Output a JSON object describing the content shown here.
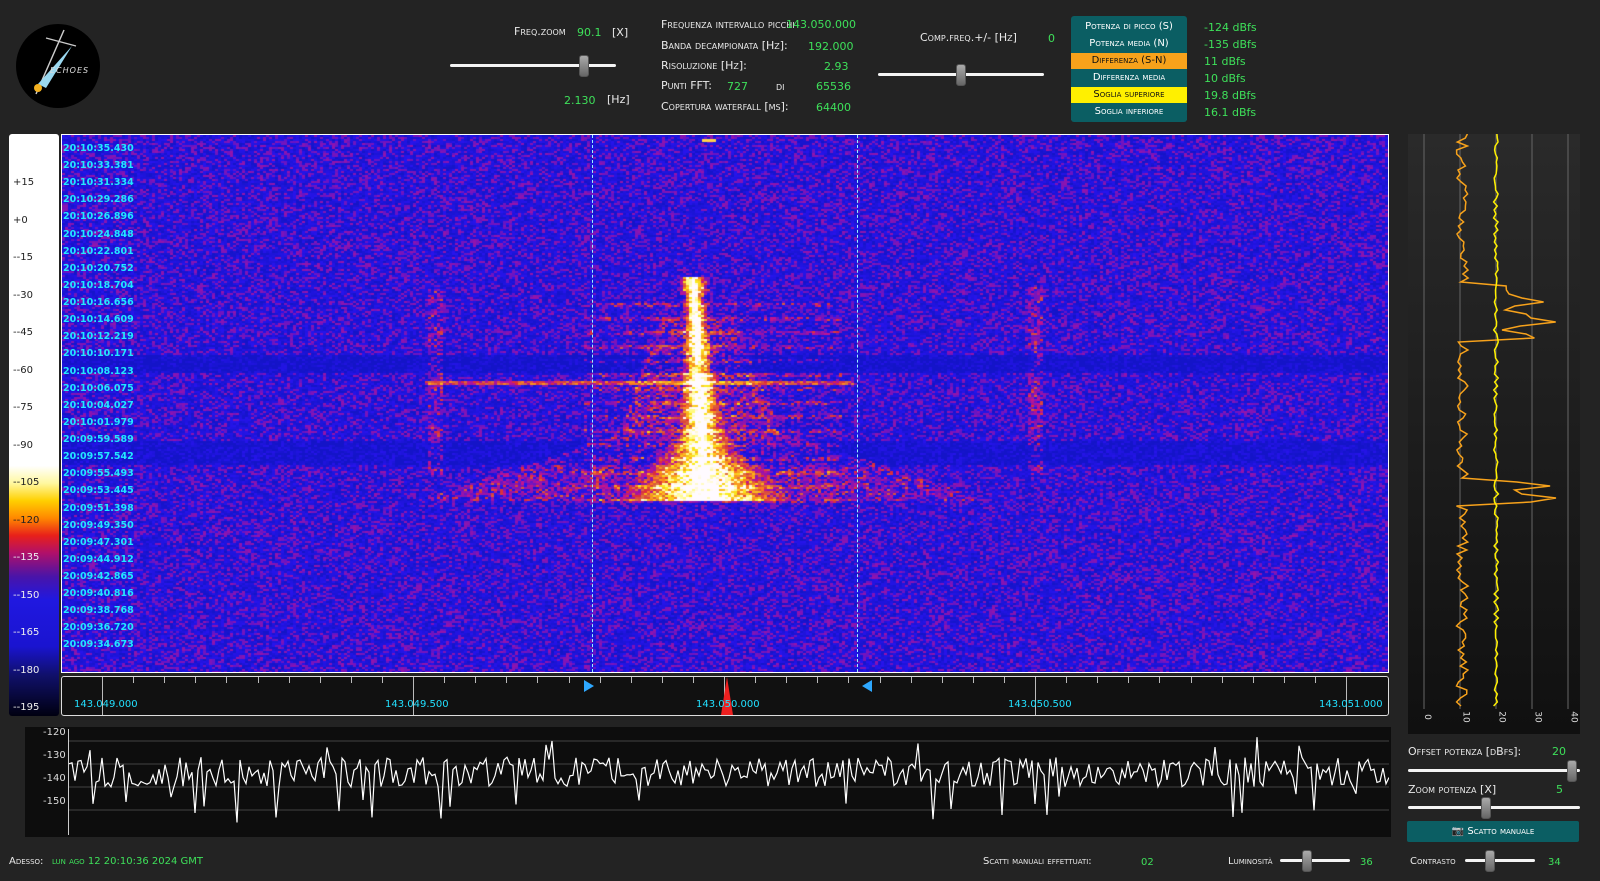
{
  "logo": {
    "text": "ECHOES"
  },
  "freq_zoom": {
    "label": "Freq.zoom",
    "value": "90.1",
    "unit": "[X]",
    "hz_value": "2.130",
    "hz_unit": "[Hz]",
    "slider_fraction": 0.83
  },
  "info": {
    "peak_interval_label": "Frequenza intervallo picchi",
    "peak_interval_value": "143.050.000",
    "decimated_band_label": "Banda decampionata [Hz]:",
    "decimated_band_value": "192.000",
    "resolution_label": "Risoluzione [Hz]:",
    "resolution_value": "2.93",
    "fft_points_label": "Punti FFT:",
    "fft_points_value": "727",
    "fft_points_of": "di",
    "fft_points_total": "65536",
    "waterfall_coverage_label": "Copertura waterfall [ms]:",
    "waterfall_coverage_value": "64400"
  },
  "comp_freq": {
    "label": "Comp.freq.+/- [Hz]",
    "value": "0",
    "slider_fraction": 0.5
  },
  "power_buttons": [
    {
      "label": "Potenza di picco (S)",
      "value": "-124 dBfs",
      "bg": "#0b5e63",
      "fg": "#ffffff"
    },
    {
      "label": "Potenza media (N)",
      "value": "-135 dBfs",
      "bg": "#0b5e63",
      "fg": "#ffffff"
    },
    {
      "label": "Differenza (S-N)",
      "value": "11 dBfs",
      "bg": "#f7a21b",
      "fg": "#111111"
    },
    {
      "label": "Differenza media",
      "value": "10 dBfs",
      "bg": "#0b5e63",
      "fg": "#ffffff"
    },
    {
      "label": "Soglia superiore",
      "value": "19.8 dBfs",
      "bg": "#fff000",
      "fg": "#111111"
    },
    {
      "label": "Soglia inferiore",
      "value": "16.1 dBfs",
      "bg": "#0b5e63",
      "fg": "#ffffff"
    }
  ],
  "colorbar": {
    "labels": [
      "+15",
      "+0",
      "--15",
      "--30",
      "--45",
      "--60",
      "--75",
      "--90",
      "--105",
      "--120",
      "--135",
      "--150",
      "--165",
      "--180",
      "--195"
    ]
  },
  "waterfall_times": [
    "20:10:35.430",
    "20:10:33.381",
    "20:10:31.334",
    "20:10:29.286",
    "20:10:26.896",
    "20:10:24.848",
    "20:10:22.801",
    "20:10:20.752",
    "20:10:18.704",
    "20:10:16.656",
    "20:10:14.609",
    "20:10:12.219",
    "20:10:10.171",
    "20:10:08.123",
    "20:10:06.075",
    "20:10:04.027",
    "20:10:01.979",
    "20:09:59.589",
    "20:09:57.542",
    "20:09:55.493",
    "20:09:53.445",
    "20:09:51.398",
    "20:09:49.350",
    "20:09:47.301",
    "20:09:44.912",
    "20:09:42.865",
    "20:09:40.816",
    "20:09:38.768",
    "20:09:36.720",
    "20:09:34.673"
  ],
  "freq_axis": {
    "labels": [
      "143.049.000",
      "143.049.500",
      "143.050.000",
      "143.050.500",
      "143.051.000"
    ]
  },
  "signal": {
    "labels": [
      "-120",
      "-130",
      "-140",
      "-150"
    ]
  },
  "right_panel": {
    "ticks": [
      "0",
      "10",
      "20",
      "30",
      "40"
    ]
  },
  "offset_power": {
    "label": "Offset potenza [dBfs]:",
    "value": "20",
    "slider_fraction": 0.98
  },
  "zoom_power": {
    "label": "Zoom potenza [X]",
    "value": "5",
    "slider_fraction": 0.45
  },
  "manual_button": {
    "label": "Scatto manuale"
  },
  "status": {
    "now_label": "Adesso:",
    "now_value": "lun ago 12 20:10:36 2024 GMT"
  },
  "manual_shots": {
    "label": "Scatti manuali effettuati:",
    "value": "02"
  },
  "brightness": {
    "label": "Luminosità",
    "value": "36",
    "slider_fraction": 0.36
  },
  "contrast": {
    "label": "Contrasto",
    "value": "34",
    "slider_fraction": 0.34
  }
}
